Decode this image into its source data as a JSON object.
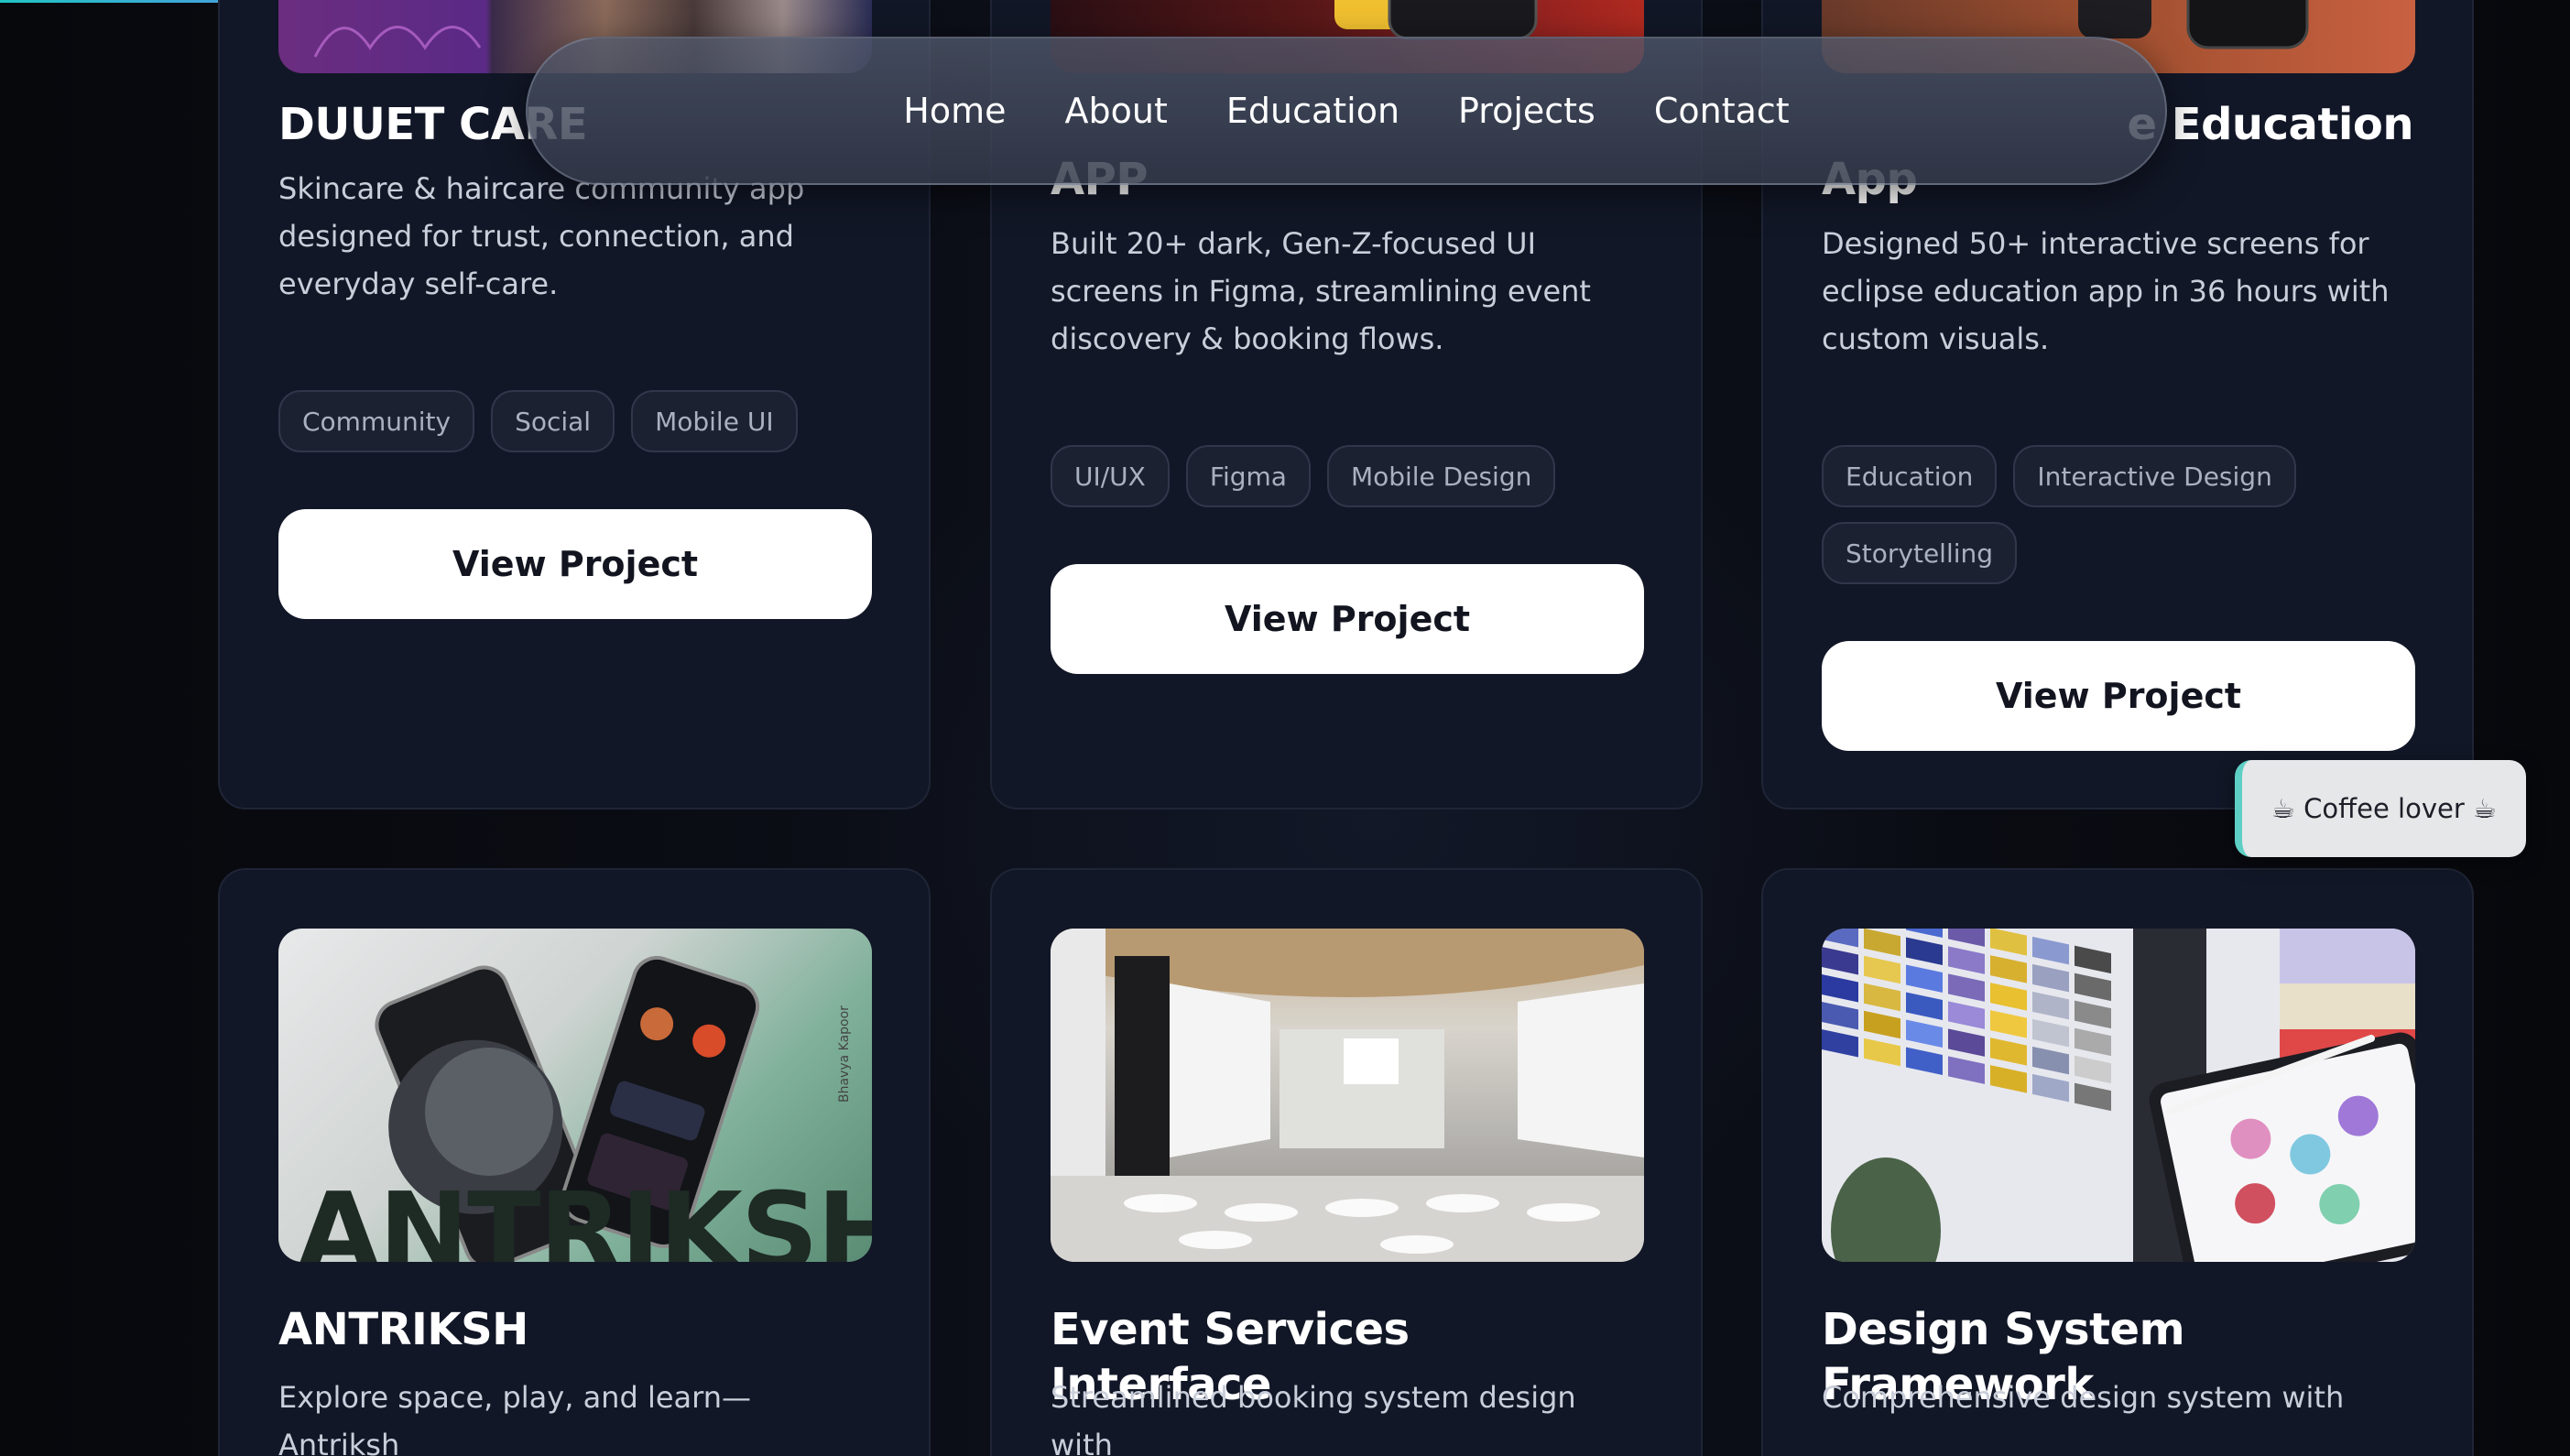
{
  "nav": {
    "links": [
      "Home",
      "About",
      "Education",
      "Projects",
      "Contact"
    ]
  },
  "badge": {
    "icon": "coffee-cup-icon",
    "text": "☕ Coffee lover ☕"
  },
  "cards": [
    {
      "title": "DUUET CARE",
      "description": "Skincare & haircare community app designed for trust, connection, and everyday self-care.",
      "tags": [
        "Community",
        "Social",
        "Mobile UI"
      ],
      "button": "View Project"
    },
    {
      "title": "APP",
      "description": "Built 20+ dark, Gen-Z-focused UI screens in Figma, streamlining event discovery & booking flows.",
      "tags": [
        "UI/UX",
        "Figma",
        "Mobile Design"
      ],
      "button": "View Project"
    },
    {
      "title_line1": "e Education",
      "title_line2": "App",
      "description": "Designed 50+ interactive screens for eclipse education app in 36 hours with custom visuals.",
      "tags": [
        "Education",
        "Interactive Design",
        "Storytelling"
      ],
      "button": "View Project"
    },
    {
      "title": "ANTRIKSH",
      "description": "Explore space, play, and learn—Antriksh",
      "image_text": "ANTRIKSH",
      "image_side_text": "Bhavya Kapoor"
    },
    {
      "title": "Event Services Interface",
      "description": "Streamlined booking system design with"
    },
    {
      "title": "Design System Framework",
      "description": "Comprehensive design system with"
    }
  ],
  "colors": {
    "background": "#0a0c12",
    "card": "#121727",
    "accent": "#5ecfc4",
    "button": "#ffffff"
  }
}
